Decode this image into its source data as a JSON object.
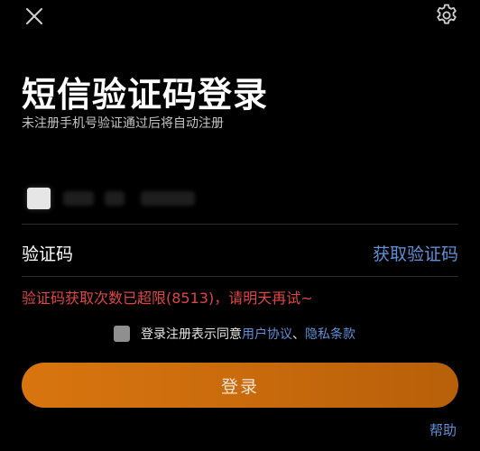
{
  "header": {
    "close_icon": "close-icon",
    "settings_icon": "gear-icon"
  },
  "page": {
    "title": "短信验证码登录",
    "subtitle": "未注册手机号验证通过后将自动注册"
  },
  "code_field": {
    "label": "验证码",
    "get_code_label": "获取验证码"
  },
  "error": {
    "message": "验证码获取次数已超限(8513)，请明天再试~"
  },
  "agreement": {
    "prefix": "登录注册表示同意",
    "user_agreement": "用户协议",
    "separator": "、",
    "privacy_policy": "隐私条款"
  },
  "login": {
    "label": "登录"
  },
  "help": {
    "label": "帮助"
  },
  "colors": {
    "background": "#000000",
    "link": "#5f8fd6",
    "error": "#e04545",
    "button": "#d8750f"
  }
}
